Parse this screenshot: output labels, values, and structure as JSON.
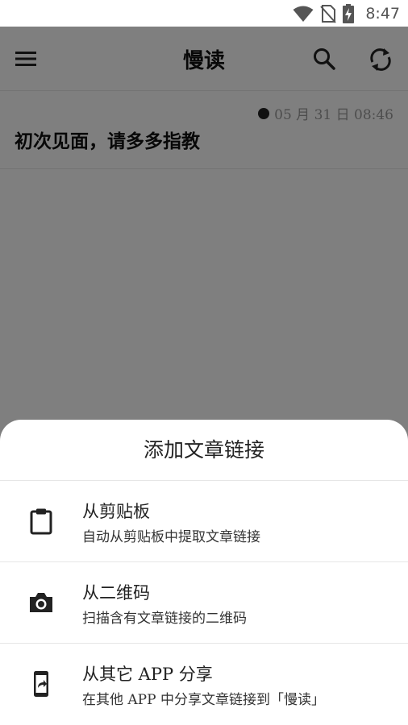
{
  "status_bar": {
    "time": "8:47",
    "icons": [
      "wifi-icon",
      "no-sim-icon",
      "battery-charging-icon"
    ]
  },
  "app_bar": {
    "title": "慢读",
    "icons": [
      "menu-icon",
      "search-icon",
      "sync-icon"
    ]
  },
  "articles": [
    {
      "date": "05 月 31 日 08:46",
      "title": "初次见面，请多多指教"
    }
  ],
  "sheet": {
    "title": "添加文章链接",
    "options": [
      {
        "icon": "clipboard-icon",
        "title": "从剪贴板",
        "description": "自动从剪贴板中提取文章链接"
      },
      {
        "icon": "camera-icon",
        "title": "从二维码",
        "description": "扫描含有文章链接的二维码"
      },
      {
        "icon": "phone-share-icon",
        "title": "从其它 APP 分享",
        "description": "在其他 APP 中分享文章链接到「慢读」"
      }
    ]
  },
  "colors": {
    "scrim": "#808080",
    "icon": "#222222",
    "muted_text": "#9a9a9a"
  }
}
